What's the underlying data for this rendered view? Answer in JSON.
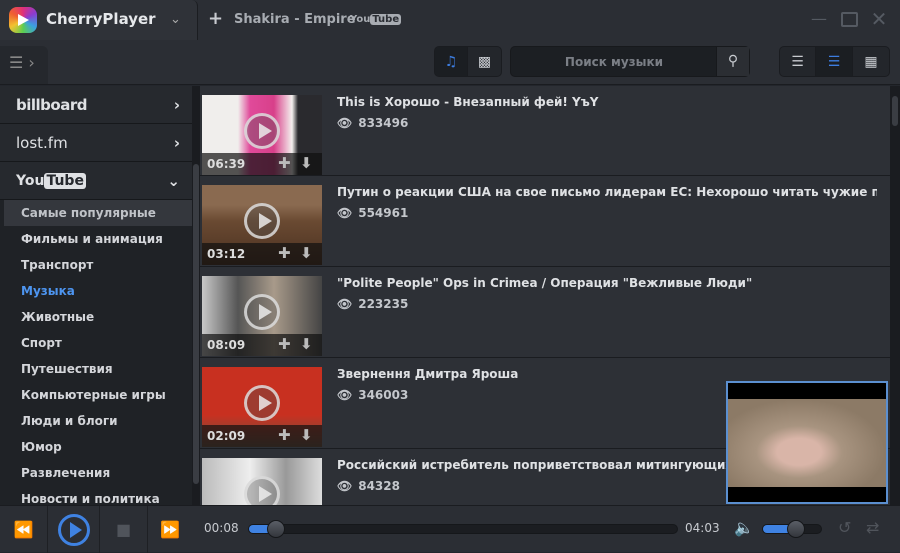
{
  "app": {
    "title": "CherryPlayer",
    "tab_title": "Shakira - Empire",
    "tab_source": {
      "you": "You",
      "tube": "Tube"
    }
  },
  "toolbar": {
    "search_placeholder": "Поиск музыки",
    "mode": "music",
    "view": "detailed-list"
  },
  "sidebar": {
    "providers": [
      {
        "label": "billboard"
      },
      {
        "label": "lost.fm"
      },
      {
        "label": "You",
        "label2": "Tube"
      }
    ],
    "categories": [
      "Самые популярные",
      "Фильмы и анимация",
      "Транспорт",
      "Музыка",
      "Животные",
      "Спорт",
      "Путешествия",
      "Компьютерные игры",
      "Люди и блоги",
      "Юмор",
      "Развлечения",
      "Новости и политика"
    ],
    "selected_category": "Самые популярные",
    "active_category": "Музыка"
  },
  "videos": [
    {
      "title": "This is Хорошо - Внезапный фей! YъY",
      "views": "833496",
      "duration": "06:39"
    },
    {
      "title": "Путин о реакции США на свое письмо лидерам ЕС: Нехорошо читать чужие письма",
      "views": "554961",
      "duration": "03:12"
    },
    {
      "title": "\"Polite People\" Ops in Crimea / Операция \"Вежливые Люди\"",
      "views": "223235",
      "duration": "08:09"
    },
    {
      "title": "Звернення Дмитра Яроша",
      "views": "346003",
      "duration": "02:09"
    },
    {
      "title": "Российский истребитель поприветствовал митингующих в Симферополе",
      "views": "84328",
      "duration": ""
    }
  ],
  "player": {
    "elapsed": "00:08",
    "total": "04:03",
    "progress": 0.033,
    "volume": 0.55
  },
  "colors": {
    "accent": "#3f82e2",
    "background": "#2b2e34"
  }
}
